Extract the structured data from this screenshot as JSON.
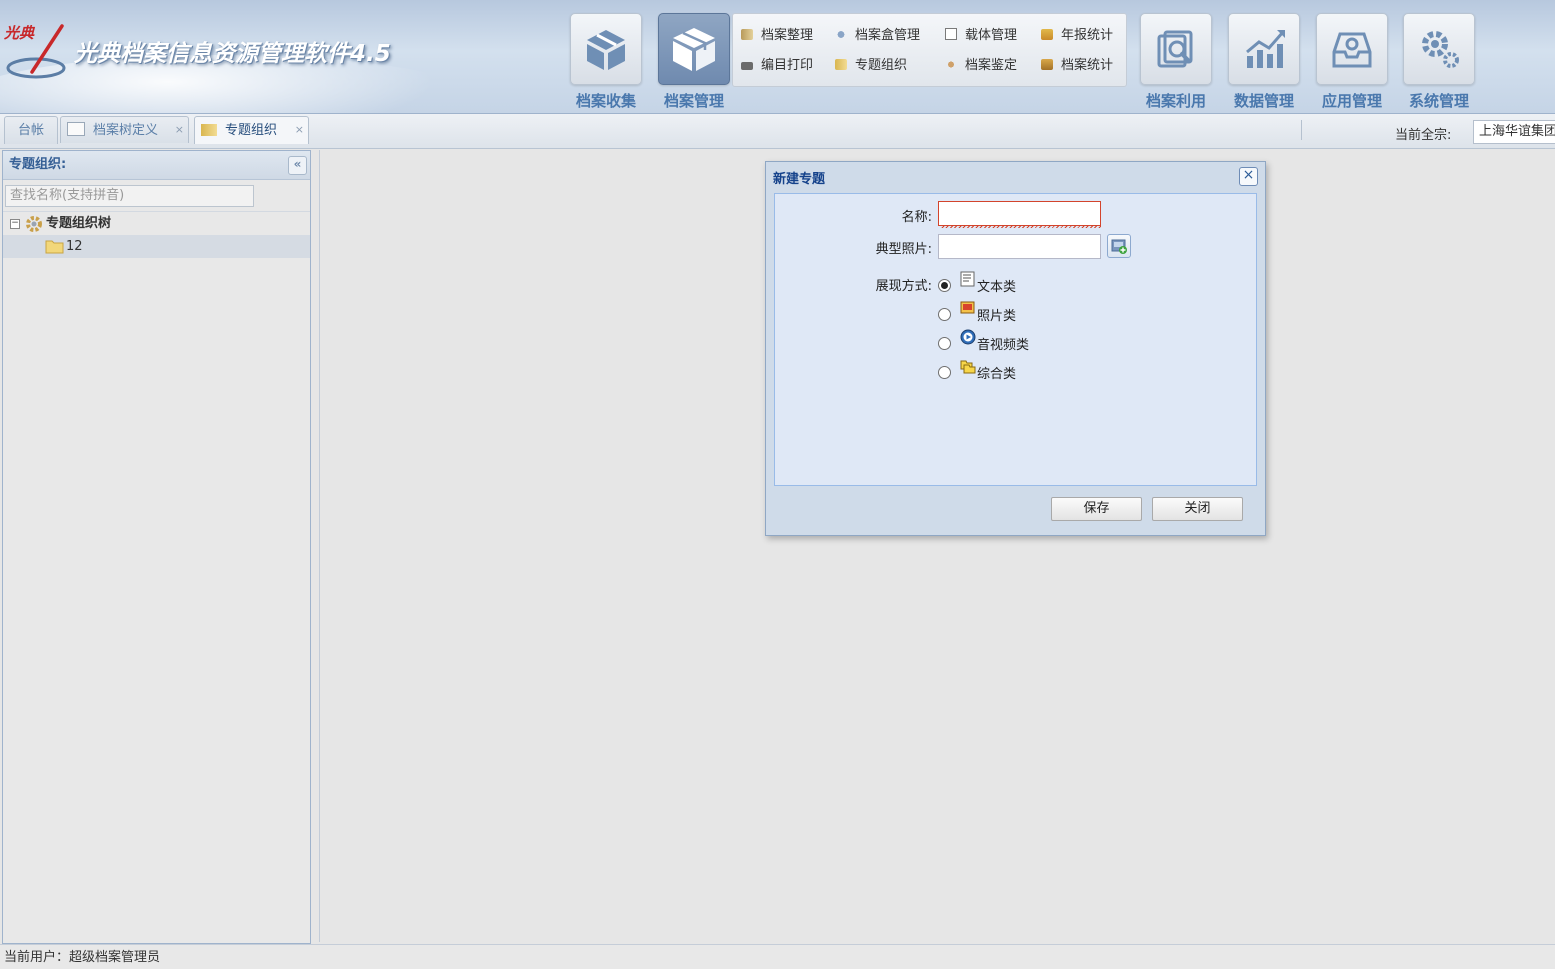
{
  "app": {
    "logo_text": "光典",
    "title": "光典档案信息资源管理软件4.5"
  },
  "nav": {
    "collect": "档案收集",
    "manage": "档案管理",
    "use": "档案利用",
    "data": "数据管理",
    "app": "应用管理",
    "system": "系统管理"
  },
  "submenu": {
    "items": [
      "档案整理",
      "档案盒管理",
      "载体管理",
      "年报统计",
      "编目打印",
      "专题组织",
      "档案鉴定",
      "档案统计"
    ]
  },
  "tabs": [
    {
      "label": "台帐"
    },
    {
      "label": "档案树定义",
      "close": "×"
    },
    {
      "label": "专题组织",
      "close": "×"
    }
  ],
  "fonds": {
    "label": "当前全宗:",
    "value": "上海华谊集团"
  },
  "left_panel": {
    "title": "专题组织:",
    "collapse_icon": "«",
    "search_placeholder": "查找名称(支持拼音)",
    "tree": {
      "expander": "−",
      "root": "专题组织树",
      "children": [
        "12"
      ]
    }
  },
  "dialog": {
    "title": "新建专题",
    "close_icon": "×",
    "name_label": "名称:",
    "name_value": "",
    "photo_label": "典型照片:",
    "photo_value": "",
    "display_label": "展现方式:",
    "display_options": [
      "文本类",
      "照片类",
      "音视频类",
      "综合类"
    ],
    "selected_option": "文本类",
    "save": "保存",
    "close": "关闭"
  },
  "status": {
    "user": "当前用户：超级档案管理员"
  },
  "colors": {
    "accent": "#4a78ad",
    "dialog_title": "#15428b",
    "invalid": "#d3442c"
  }
}
